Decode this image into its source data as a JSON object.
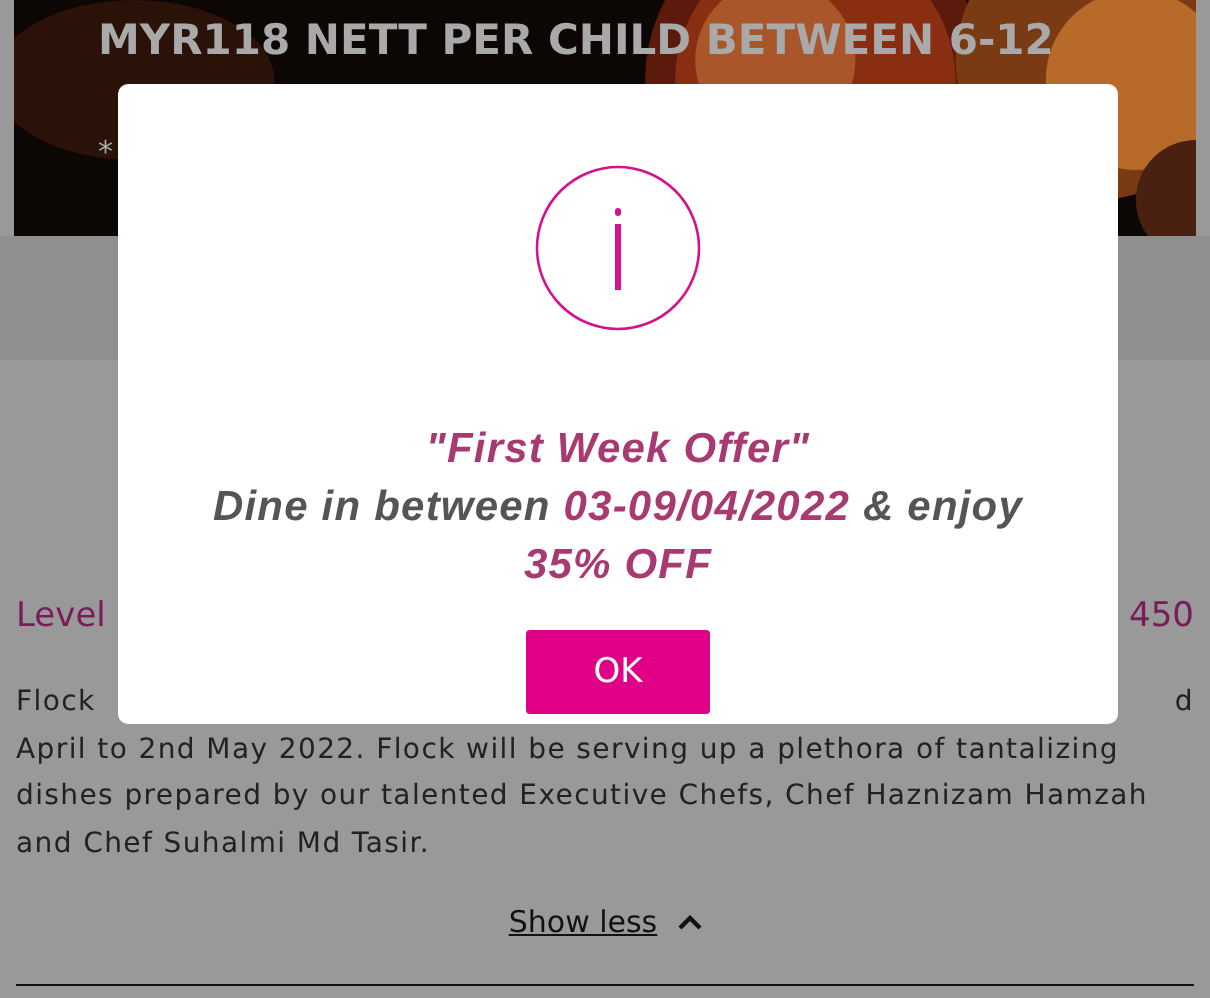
{
  "banner": {
    "headline": "MYR118 NETT PER CHILD BETWEEN 6-12",
    "note": "*",
    "kind": "picture"
  },
  "location": {
    "start": "Level",
    "end": "450"
  },
  "description": {
    "first_line_start": "Flock",
    "first_line_end": "d",
    "lines": [
      "April to 2nd May 2022. Flock will be serving up a plethora of tantalizing",
      "dishes prepared by our talented Executive Chefs, Chef Haznizam Hamzah",
      "and Chef Suhalmi Md Tasir."
    ]
  },
  "toggle": {
    "label": "Show less",
    "expanded": true
  },
  "dialog": {
    "title": "\"First Week Offer\"",
    "message": [
      {
        "text": "Dine in between",
        "highlight": false
      },
      {
        "text": "03-09/04/2022",
        "highlight": true
      },
      {
        "text": "& enjoy",
        "highlight": false
      }
    ],
    "offer": "35% OFF",
    "button": "OK"
  }
}
